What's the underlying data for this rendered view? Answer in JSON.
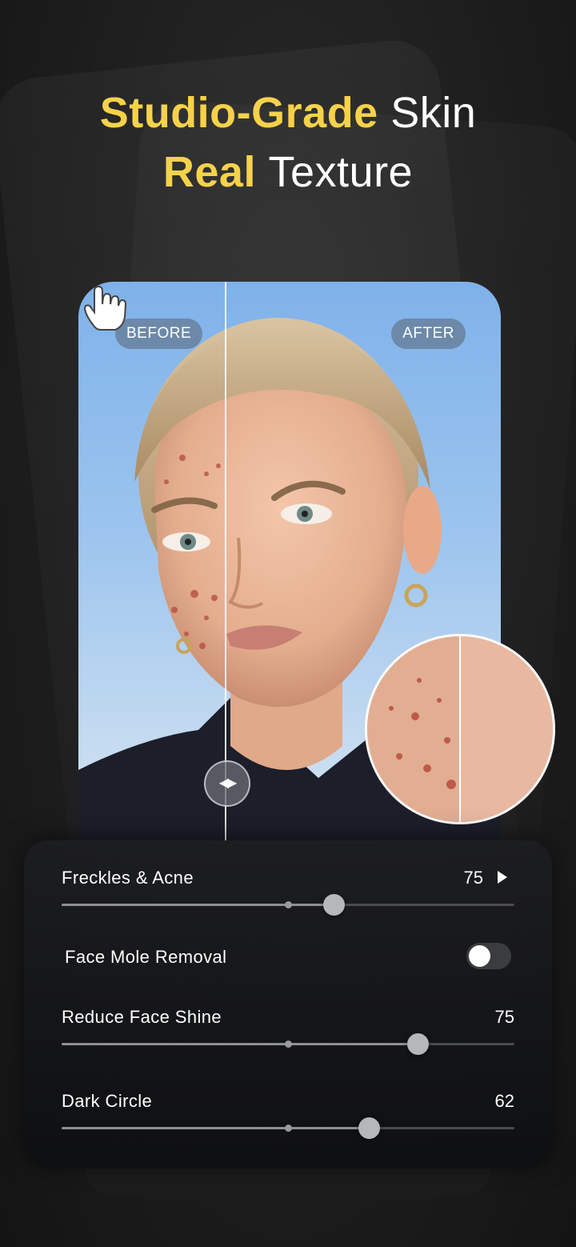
{
  "headline": {
    "line1_highlight": "Studio-Grade",
    "line1_plain": "Skin",
    "line2_highlight": "Real",
    "line2_plain": "Texture"
  },
  "compare": {
    "before_label": "BEFORE",
    "after_label": "AFTER",
    "handle_glyph": "◀▶"
  },
  "controls": {
    "freckles": {
      "label": "Freckles & Acne",
      "value": "75",
      "level": 0.6
    },
    "mole": {
      "label": "Face Mole Removal",
      "enabled": false
    },
    "shine": {
      "label": "Reduce Face Shine",
      "value": "75",
      "level": 0.786
    },
    "dark_circle": {
      "label": "Dark Circle",
      "value": "62",
      "level": 0.678
    }
  },
  "colors": {
    "accent": "#f6d24a",
    "panel": "#1a1b1e",
    "track": "#4a4b4e",
    "thumb": "#b6b7bb"
  },
  "icons": {
    "play": "play-icon",
    "handle": "compare-handle-icon",
    "hand": "pointer-hand-icon"
  }
}
